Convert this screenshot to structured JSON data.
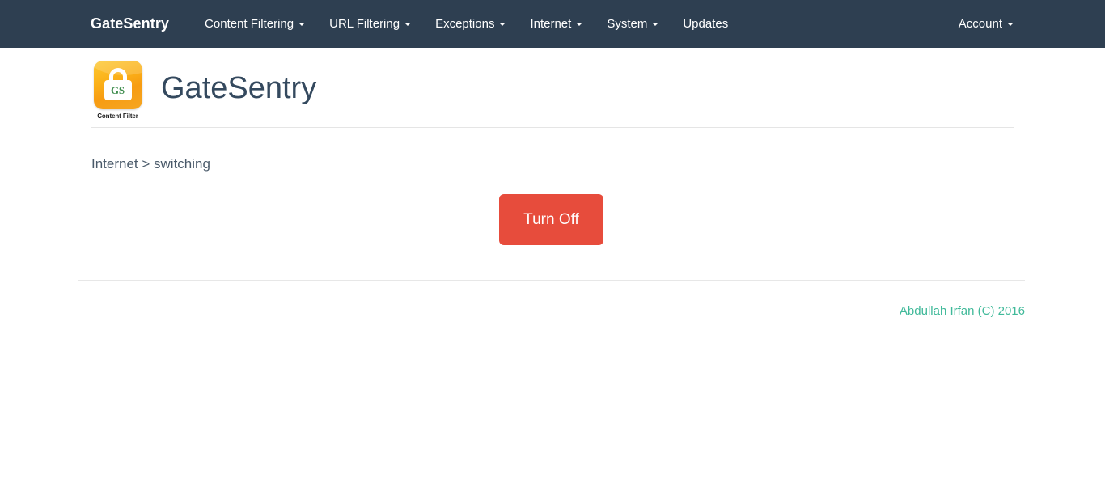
{
  "navbar": {
    "brand": "GateSentry",
    "items": [
      {
        "label": "Content Filtering",
        "caret": true
      },
      {
        "label": "URL Filtering",
        "caret": true
      },
      {
        "label": "Exceptions",
        "caret": true
      },
      {
        "label": "Internet",
        "caret": true
      },
      {
        "label": "System",
        "caret": true
      },
      {
        "label": "Updates",
        "caret": false
      }
    ],
    "account": {
      "label": "Account",
      "caret": true
    }
  },
  "header": {
    "title": "GateSentry",
    "logo": {
      "mark_text": "GS",
      "caption": "Content Filter",
      "icon": "padlock-icon"
    }
  },
  "main": {
    "breadcrumb": "Internet > switching",
    "action_button": "Turn Off"
  },
  "footer": {
    "copyright": "Abdullah Irfan (C) 2016"
  },
  "colors": {
    "navbar_bg": "#2e3f51",
    "title": "#34495e",
    "danger_button": "#e74c3c",
    "footer_text": "#3fb999",
    "logo_orange": "#f5a623",
    "logo_green": "#3f8d4e"
  }
}
